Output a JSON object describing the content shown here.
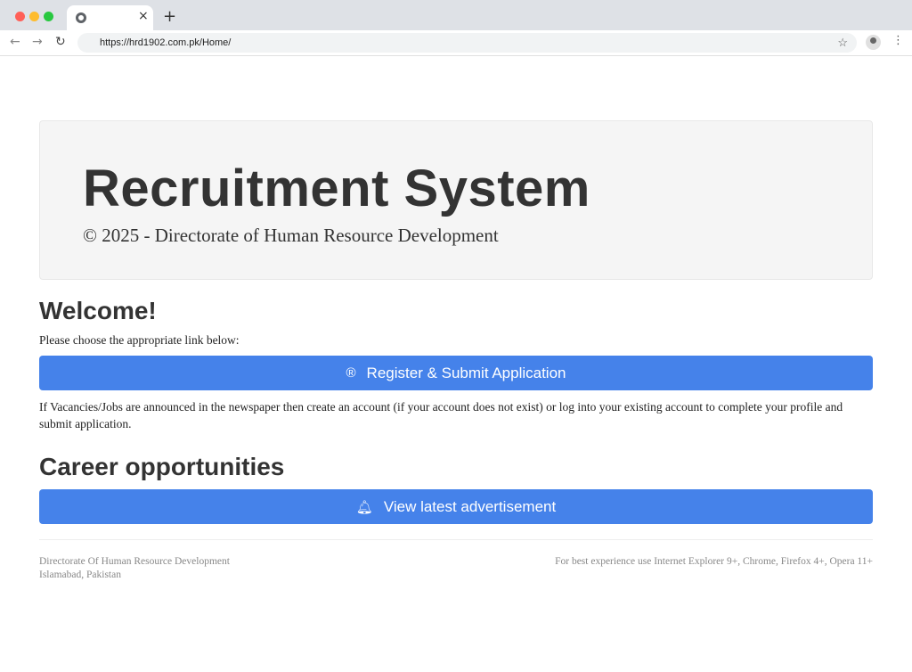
{
  "browser": {
    "url": "https://hrd1902.com.pk/Home/",
    "new_tab": "+",
    "close": "×"
  },
  "header": {
    "title": "Recruitment System",
    "subtitle": "© 2025 - Directorate of Human Resource Development"
  },
  "welcome": {
    "heading": "Welcome!",
    "intro": "Please choose the appropriate link below:",
    "register_button": "Register & Submit Application",
    "register_icon": "registered-icon",
    "help": "If Vacancies/Jobs are announced in the newspaper then create an account (if your account does not exist) or log into your existing account to complete your profile and submit application."
  },
  "career": {
    "heading": "Career opportunities",
    "button": "View latest advertisement",
    "icon": "bell-icon"
  },
  "footer": {
    "org": "Directorate Of Human Resource Development",
    "location": "Islamabad, Pakistan",
    "note": "For best experience use Internet Explorer 9+, Chrome, Firefox 4+, Opera 11+"
  },
  "colors": {
    "button": "#4582ea"
  }
}
